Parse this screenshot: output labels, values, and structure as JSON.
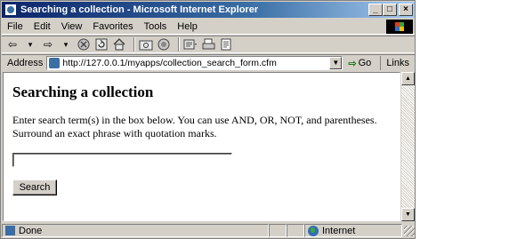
{
  "window": {
    "title": "Searching a collection - Microsoft Internet Explorer",
    "buttons": {
      "minimize": "_",
      "maximize": "□",
      "close": "×"
    }
  },
  "menu": [
    {
      "label": "File"
    },
    {
      "label": "Edit"
    },
    {
      "label": "View"
    },
    {
      "label": "Favorites"
    },
    {
      "label": "Tools"
    },
    {
      "label": "Help"
    }
  ],
  "toolbar": {
    "back": "⇦",
    "back_dropdown": "▾",
    "forward": "⇨",
    "forward_dropdown": "▾"
  },
  "address": {
    "label": "Address",
    "url": "http://127.0.0.1/myapps/collection_search_form.cfm",
    "dropdown": "▼",
    "go": "Go",
    "go_arrow": "⇨",
    "links": "Links"
  },
  "page": {
    "heading": "Searching a collection",
    "instructions": "Enter search term(s) in the box below. You can use AND, OR, NOT, and parentheses. Surround an exact phrase with quotation marks.",
    "search_value": "",
    "search_button": "Search"
  },
  "scrollbar": {
    "up": "▲",
    "down": "▼"
  },
  "status": {
    "text": "Done",
    "zone": "Internet"
  },
  "colors": {
    "title_gradient_start": "#0a246a",
    "chrome": "#d4d0c8"
  }
}
